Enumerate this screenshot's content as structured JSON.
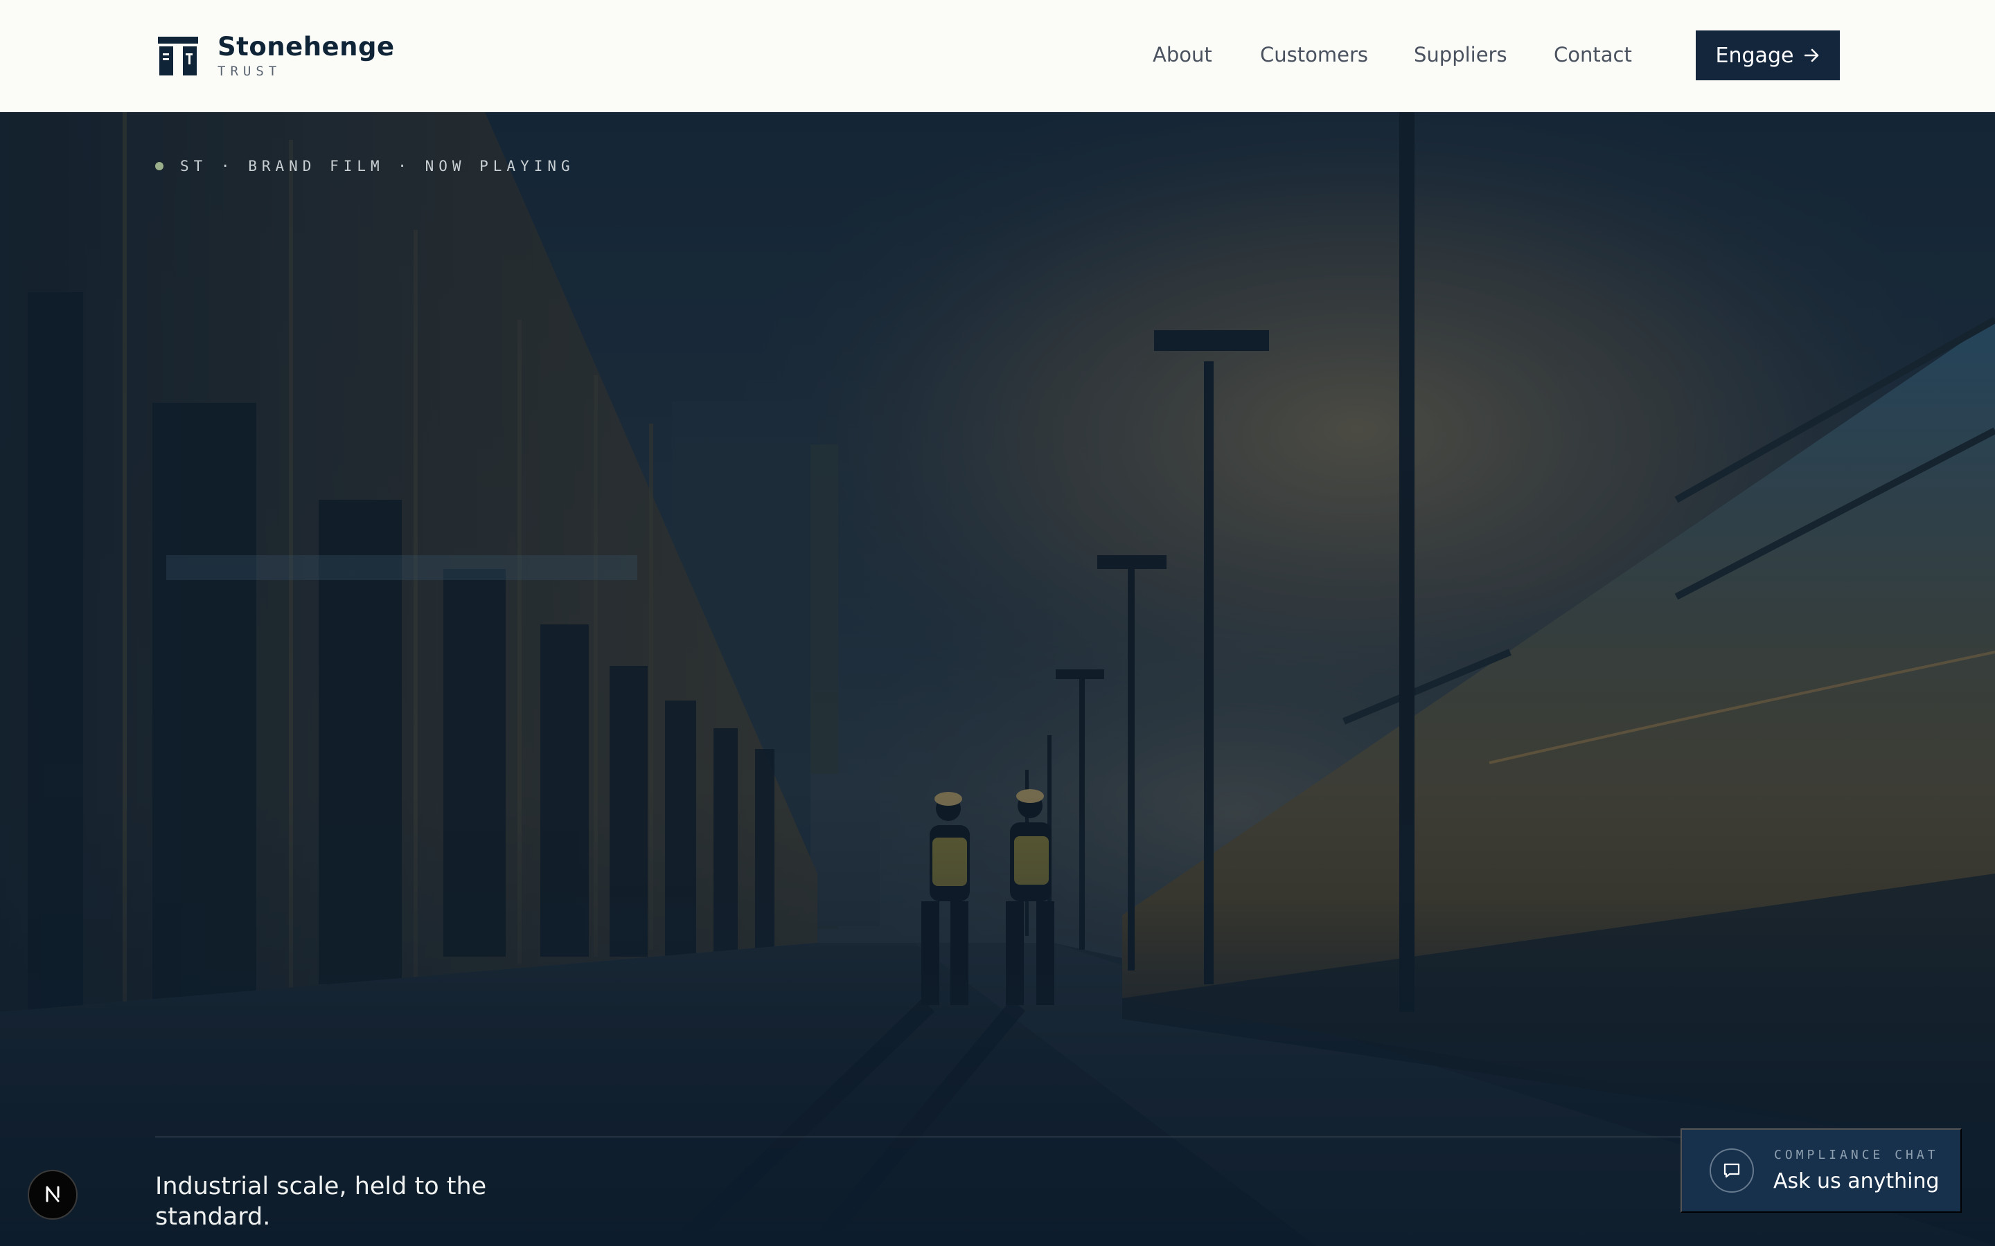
{
  "header": {
    "brand_name": "Stonehenge",
    "brand_sub": "TRUST",
    "nav": [
      {
        "label": "About"
      },
      {
        "label": "Customers"
      },
      {
        "label": "Suppliers"
      },
      {
        "label": "Contact"
      }
    ],
    "cta_label": "Engage",
    "cta_icon": "arrow-right-icon"
  },
  "hero": {
    "eyebrow": "ST · BRAND FILM · NOW PLAYING",
    "tagline": "Industrial scale, held to the standard.",
    "video_icon": "brand-film-video"
  },
  "chat": {
    "label": "COMPLIANCE CHAT",
    "title": "Ask us anything",
    "icon": "chat-bubble-icon"
  },
  "badge": {
    "letter": "N"
  },
  "colors": {
    "header_bg": "#fbfcf7",
    "brand_navy": "#13263c",
    "hero_overlay": "#0d1e2d",
    "chat_bg": "#17314d",
    "eyebrow_dot": "#9bb08a"
  }
}
